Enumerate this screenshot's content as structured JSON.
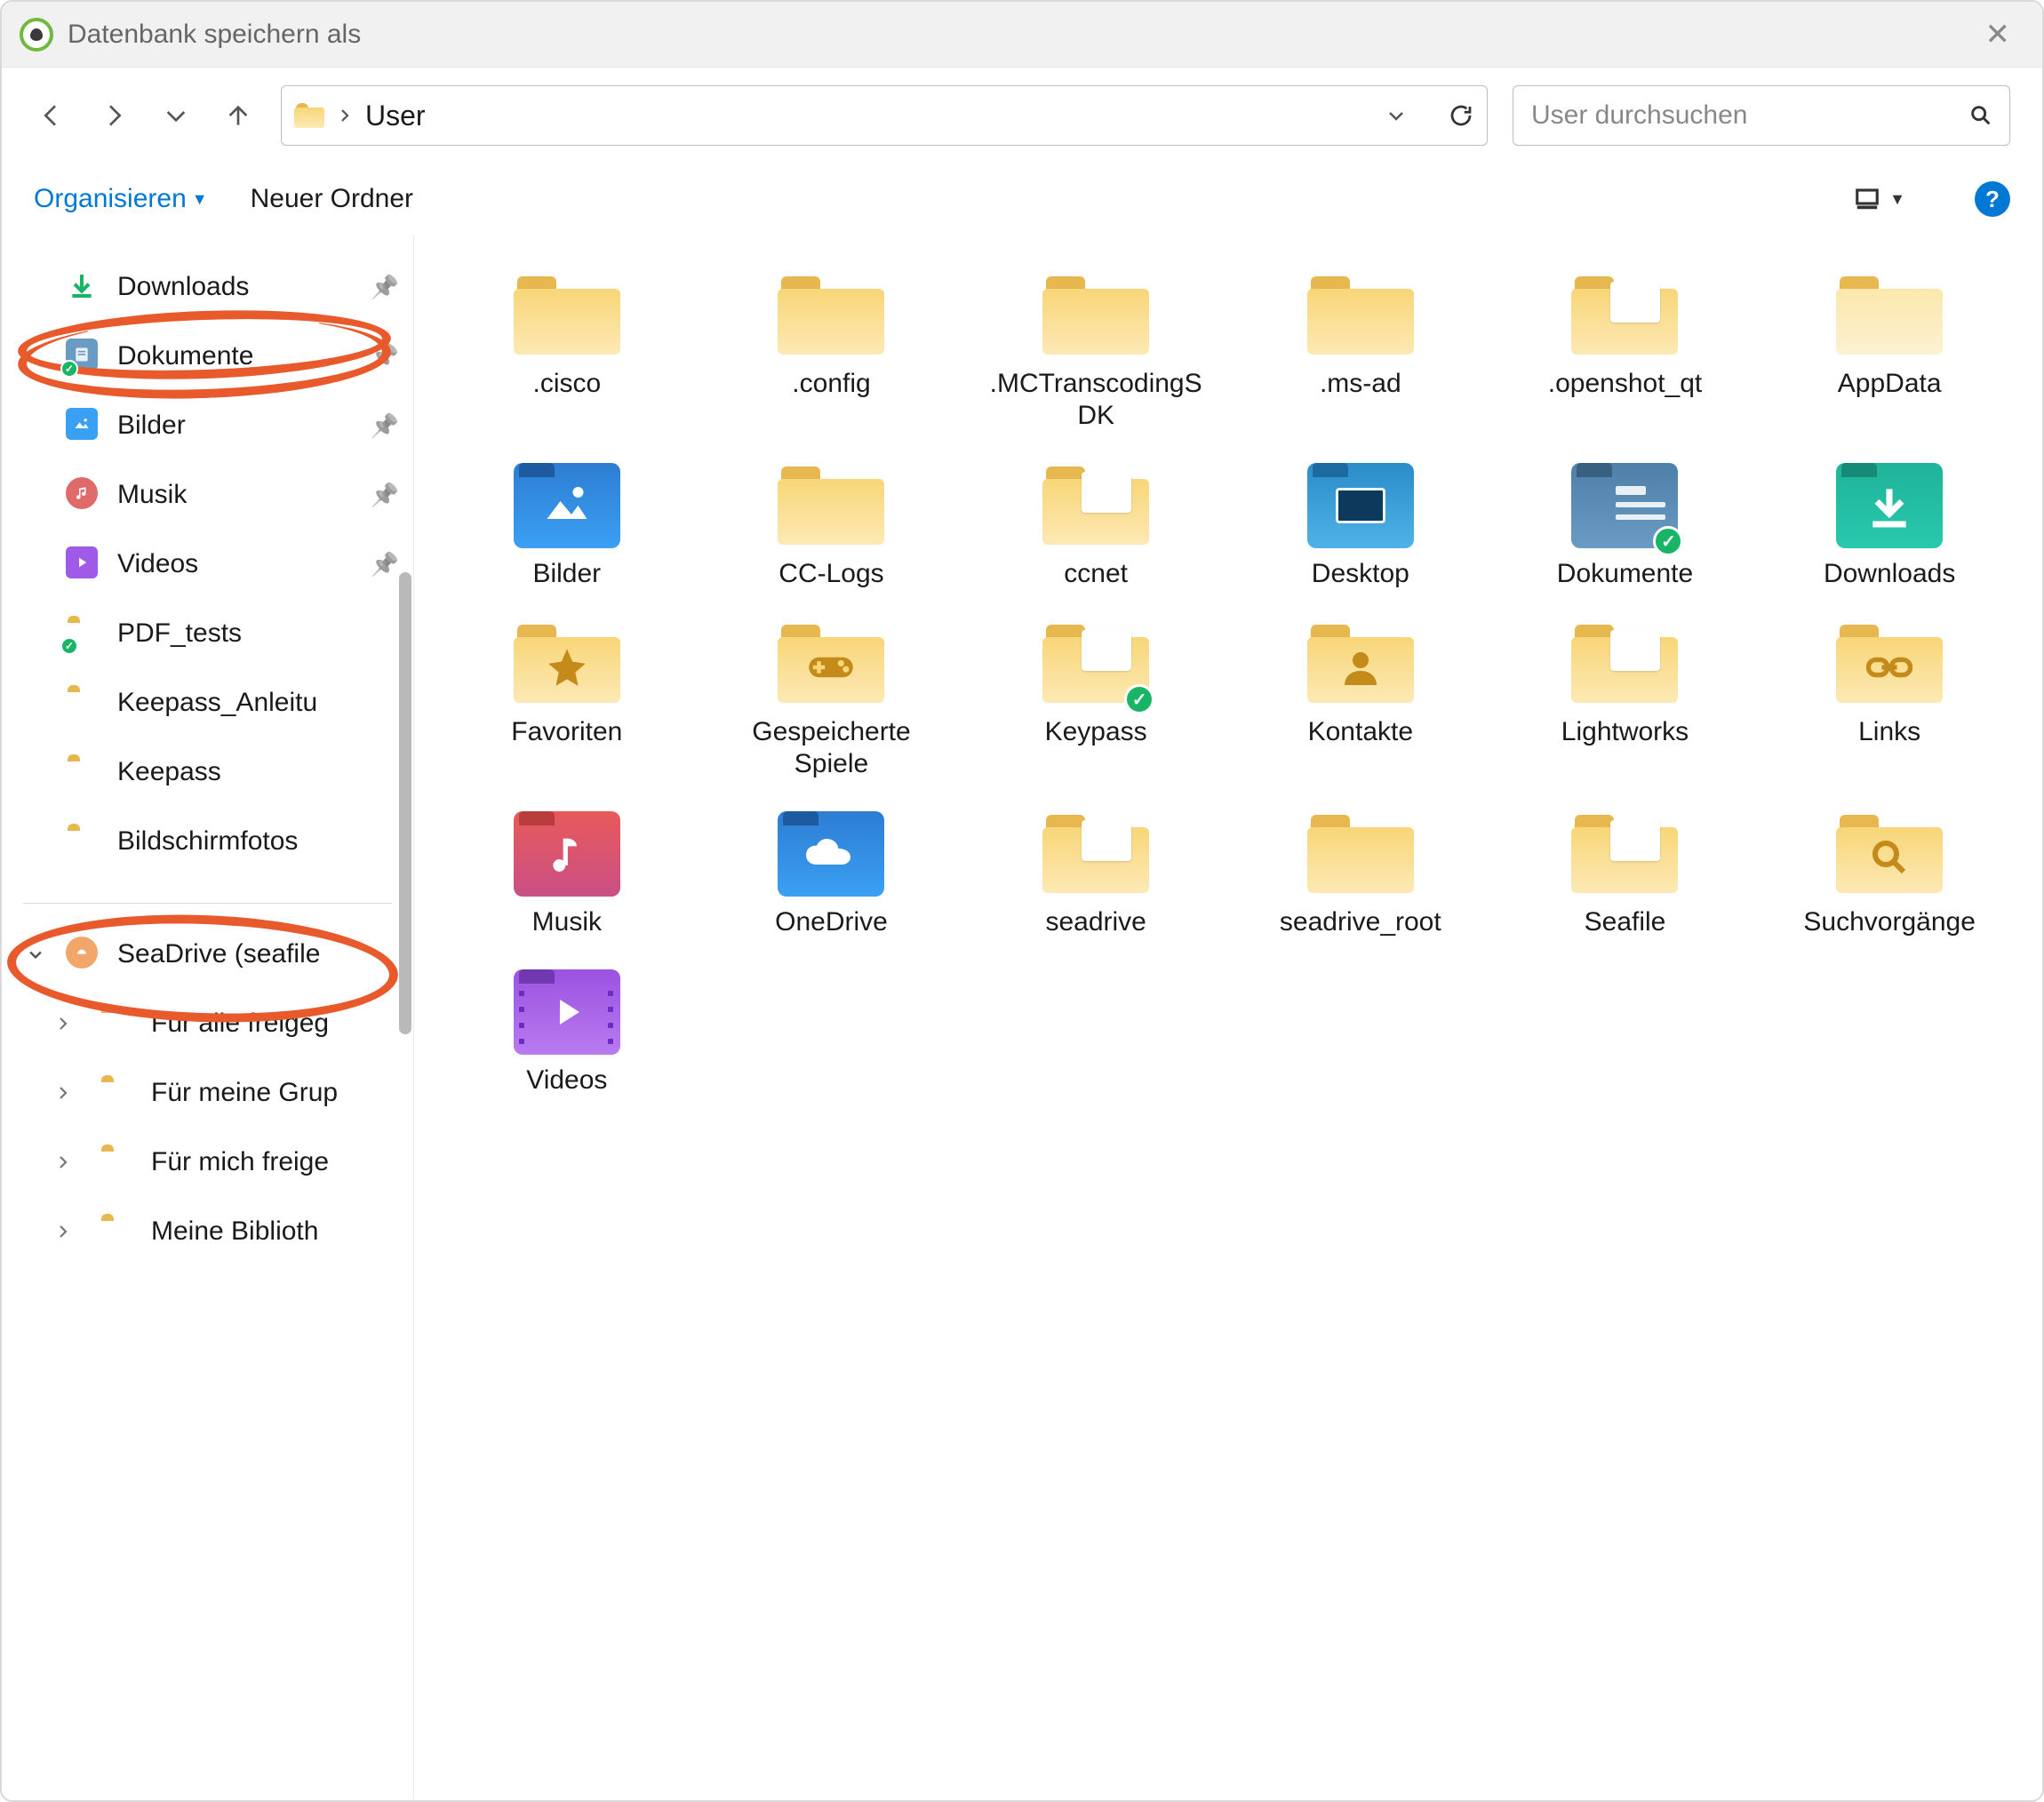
{
  "window": {
    "title": "Datenbank speichern als"
  },
  "nav": {
    "path_segments": [
      "User"
    ],
    "search_placeholder": "User durchsuchen"
  },
  "toolbar": {
    "organize": "Organisieren",
    "new_folder": "Neuer Ordner"
  },
  "sidebar": {
    "quick": [
      {
        "id": "downloads",
        "label": "Downloads",
        "icon": "downloads",
        "pinned": true
      },
      {
        "id": "dokumente",
        "label": "Dokumente",
        "icon": "documents",
        "pinned": true,
        "sync": true,
        "highlight": true
      },
      {
        "id": "bilder",
        "label": "Bilder",
        "icon": "pictures",
        "pinned": true
      },
      {
        "id": "musik",
        "label": "Musik",
        "icon": "music",
        "pinned": true
      },
      {
        "id": "videos",
        "label": "Videos",
        "icon": "videos",
        "pinned": true
      },
      {
        "id": "pdf_tests",
        "label": "PDF_tests",
        "icon": "folder",
        "sync": true
      },
      {
        "id": "keepass_anl",
        "label": "Keepass_Anleitu",
        "icon": "folder"
      },
      {
        "id": "keepass",
        "label": "Keepass",
        "icon": "folder"
      },
      {
        "id": "screenshots",
        "label": "Bildschirmfotos",
        "icon": "folder"
      }
    ],
    "seadrive": {
      "label": "SeaDrive (seafile",
      "highlight": true,
      "children": [
        {
          "label": "Für alle freigeg"
        },
        {
          "label": "Für meine Grup"
        },
        {
          "label": "Für mich freige"
        },
        {
          "label": "Meine Biblioth"
        }
      ]
    }
  },
  "grid": [
    {
      "label": ".cisco",
      "type": "folder"
    },
    {
      "label": ".config",
      "type": "folder"
    },
    {
      "label": ".MCTranscodingSDK",
      "type": "folder"
    },
    {
      "label": ".ms-ad",
      "type": "folder"
    },
    {
      "label": ".openshot_qt",
      "type": "folder-page"
    },
    {
      "label": "AppData",
      "type": "folder-light"
    },
    {
      "label": "Bilder",
      "type": "pictures"
    },
    {
      "label": "CC-Logs",
      "type": "folder"
    },
    {
      "label": "ccnet",
      "type": "folder-page"
    },
    {
      "label": "Desktop",
      "type": "desktop"
    },
    {
      "label": "Dokumente",
      "type": "documents",
      "sync": true
    },
    {
      "label": "Downloads",
      "type": "downloads"
    },
    {
      "label": "Favoriten",
      "type": "folder-glyph",
      "glyph": "star"
    },
    {
      "label": "Gespeicherte Spiele",
      "type": "folder-glyph",
      "glyph": "gamepad"
    },
    {
      "label": "Keypass",
      "type": "folder-page",
      "sync": true
    },
    {
      "label": "Kontakte",
      "type": "folder-glyph",
      "glyph": "person"
    },
    {
      "label": "Lightworks",
      "type": "folder-page"
    },
    {
      "label": "Links",
      "type": "folder-glyph",
      "glyph": "link"
    },
    {
      "label": "Musik",
      "type": "music"
    },
    {
      "label": "OneDrive",
      "type": "onedrive"
    },
    {
      "label": "seadrive",
      "type": "folder-page"
    },
    {
      "label": "seadrive_root",
      "type": "folder"
    },
    {
      "label": "Seafile",
      "type": "folder-page"
    },
    {
      "label": "Suchvorgänge",
      "type": "folder-glyph",
      "glyph": "search"
    },
    {
      "label": "Videos",
      "type": "videos"
    }
  ]
}
